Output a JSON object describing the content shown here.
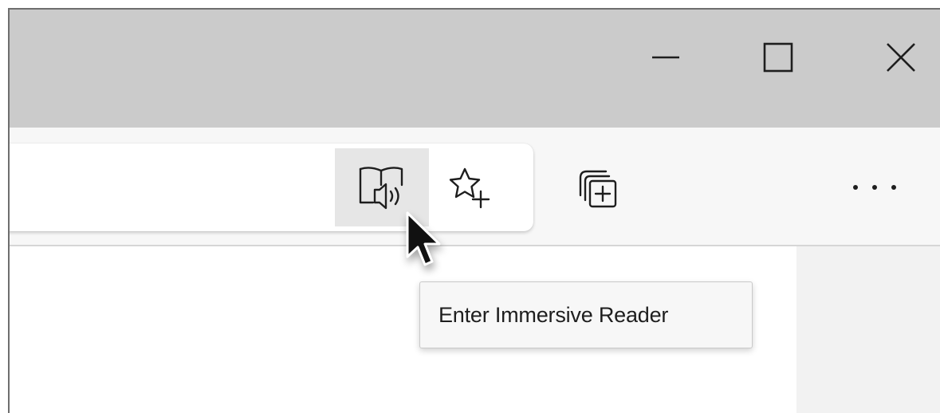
{
  "window_controls": {
    "minimize_icon": "minimize-icon",
    "maximize_icon": "maximize-icon",
    "close_icon": "close-icon"
  },
  "toolbar": {
    "immersive_reader_icon": "immersive-reader-icon",
    "add_favorite_icon": "add-to-favorites-icon",
    "collections_icon": "collections-icon",
    "more_icon": "more-horizontal-icon"
  },
  "tooltip": {
    "text": "Enter Immersive Reader"
  },
  "colors": {
    "titlebar": "#cbcbcb",
    "toolbar": "#f7f7f7",
    "hovered_button": "#e6e6e6",
    "icon": "#1e1e1e",
    "tooltip_bg": "#f7f7f7"
  }
}
